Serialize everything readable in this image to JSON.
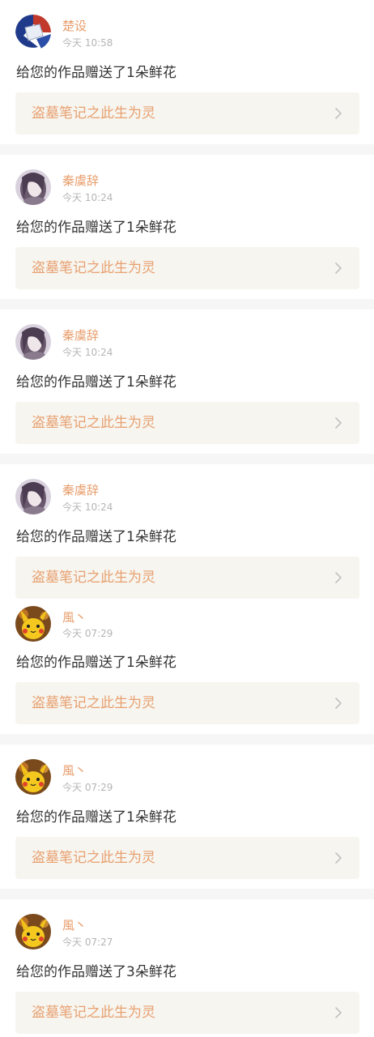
{
  "notifications": [
    {
      "avatar_icon": "avatar-blue-flag-icon",
      "user": "楚设",
      "time": "今天 10:58",
      "message": "给您的作品赠送了1朵鲜花",
      "work_title": "盗墓笔记之此生为灵",
      "chevron_icon": "chevron-right-icon"
    },
    {
      "avatar_icon": "avatar-portrait-icon",
      "user": "秦虞辞",
      "time": "今天 10:24",
      "message": "给您的作品赠送了1朵鲜花",
      "work_title": "盗墓笔记之此生为灵",
      "chevron_icon": "chevron-right-icon"
    },
    {
      "avatar_icon": "avatar-portrait-icon",
      "user": "秦虞辞",
      "time": "今天 10:24",
      "message": "给您的作品赠送了1朵鲜花",
      "work_title": "盗墓笔记之此生为灵",
      "chevron_icon": "chevron-right-icon"
    },
    {
      "avatar_icon": "avatar-portrait-icon",
      "user": "秦虞辞",
      "time": "今天 10:24",
      "message": "给您的作品赠送了1朵鲜花",
      "work_title": "盗墓笔记之此生为灵",
      "chevron_icon": "chevron-right-icon"
    },
    {
      "avatar_icon": "avatar-pikachu-icon",
      "user": "風丶",
      "time": "今天 07:29",
      "message": "给您的作品赠送了1朵鲜花",
      "work_title": "盗墓笔记之此生为灵",
      "chevron_icon": "chevron-right-icon"
    },
    {
      "avatar_icon": "avatar-pikachu-icon",
      "user": "風丶",
      "time": "今天 07:29",
      "message": "给您的作品赠送了1朵鲜花",
      "work_title": "盗墓笔记之此生为灵",
      "chevron_icon": "chevron-right-icon"
    },
    {
      "avatar_icon": "avatar-pikachu-icon",
      "user": "風丶",
      "time": "今天 07:27",
      "message": "给您的作品赠送了3朵鲜花",
      "work_title": "盗墓笔记之此生为灵",
      "chevron_icon": "chevron-right-icon"
    }
  ],
  "colors": {
    "username": "#e79c6a",
    "timestamp": "#b5b5b5",
    "message": "#333333",
    "work_title": "#e8a070",
    "link_background": "#f6f5ef",
    "separator": "#f6f6f6"
  }
}
